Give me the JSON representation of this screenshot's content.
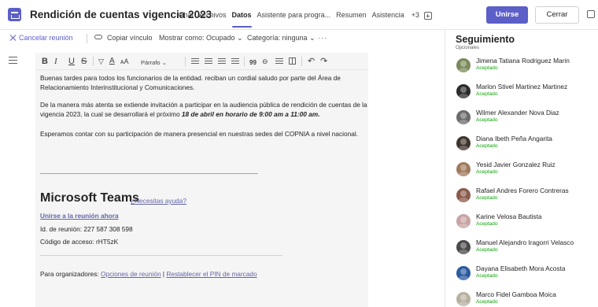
{
  "header": {
    "title": "Rendición de cuentas vigencia 2023",
    "tabs": [
      "Chat",
      "Archivos",
      "Datos",
      "Asistente para progra...",
      "Resumen",
      "Asistencia"
    ],
    "active_tab": "Datos",
    "more_tabs": "+3",
    "join_label": "Unirse",
    "close_label": "Cerrar"
  },
  "commandbar": {
    "cancel": "Cancelar reunión",
    "copy_link": "Copiar vínculo",
    "show_as": "Mostrar como: Ocupado",
    "category": "Categoría: ninguna",
    "more": "···"
  },
  "toolbar": {
    "bold": "B",
    "italic": "I",
    "underline": "U",
    "strike": "S",
    "paragraph": "Párrafo",
    "quote": "99",
    "undo": "↶",
    "redo": "↷"
  },
  "body": {
    "p1_line1": "Buenas tardes para todos los funcionarios de la entidad. reciban un cordial saludo por parte del Área de",
    "p1_line2": "Relacionamiento Interinstitucional y Comunicaciones.",
    "p2_line1": "De la manera más atenta se extiende invitación a participar en la audiencia pública de rendición de cuentas de la",
    "p2_line2_start": "vigencia 2023, la cual se desarrollará el próximo ",
    "p2_line2_bold": "18 de abril en horario de 9:00 am a 11:00 am.",
    "p3": "Esperamos contar con su participación de manera presencial en nuestras sedes del COPNIA a nivel nacional."
  },
  "teams": {
    "brand": "Microsoft Teams",
    "help": "¿Necesitas ayuda?",
    "join_link": "Unirse a la reunión ahora",
    "meeting_id": "Id. de reunión: 227 587 308 598",
    "passcode": "Código de acceso: rHT5zK",
    "org_prefix": "Para organizadores: ",
    "org_options": "Opciones de reunión",
    "org_sep": " | ",
    "org_reset": "Restablecer el PIN de marcado"
  },
  "tracking": {
    "title": "Seguimiento",
    "subtitle": "Opcionales",
    "status_color": "#13a10e",
    "people": [
      {
        "name": "Jimena Tatiana Rodriguez Marin",
        "status": "Aceptado"
      },
      {
        "name": "Marlon Stivel Martinez Martinez",
        "status": "Aceptado"
      },
      {
        "name": "Wilmer Alexander Nova Diaz",
        "status": "Aceptado"
      },
      {
        "name": "Diana Ibeth Peña Angarita",
        "status": "Aceptado"
      },
      {
        "name": "Yesid Javier Gonzalez Ruiz",
        "status": "Aceptado"
      },
      {
        "name": "Rafael Andres Forero Contreras",
        "status": "Aceptado"
      },
      {
        "name": "Karine Velosa Bautista",
        "status": "Aceptado"
      },
      {
        "name": "Manuel Alejandro Iragorri Velasco",
        "status": "Aceptado"
      },
      {
        "name": "Dayana Elisabeth Mora Acosta",
        "status": "Aceptado"
      },
      {
        "name": "Marco Fidel Gamboa Moica",
        "status": "Aceptado"
      }
    ]
  }
}
